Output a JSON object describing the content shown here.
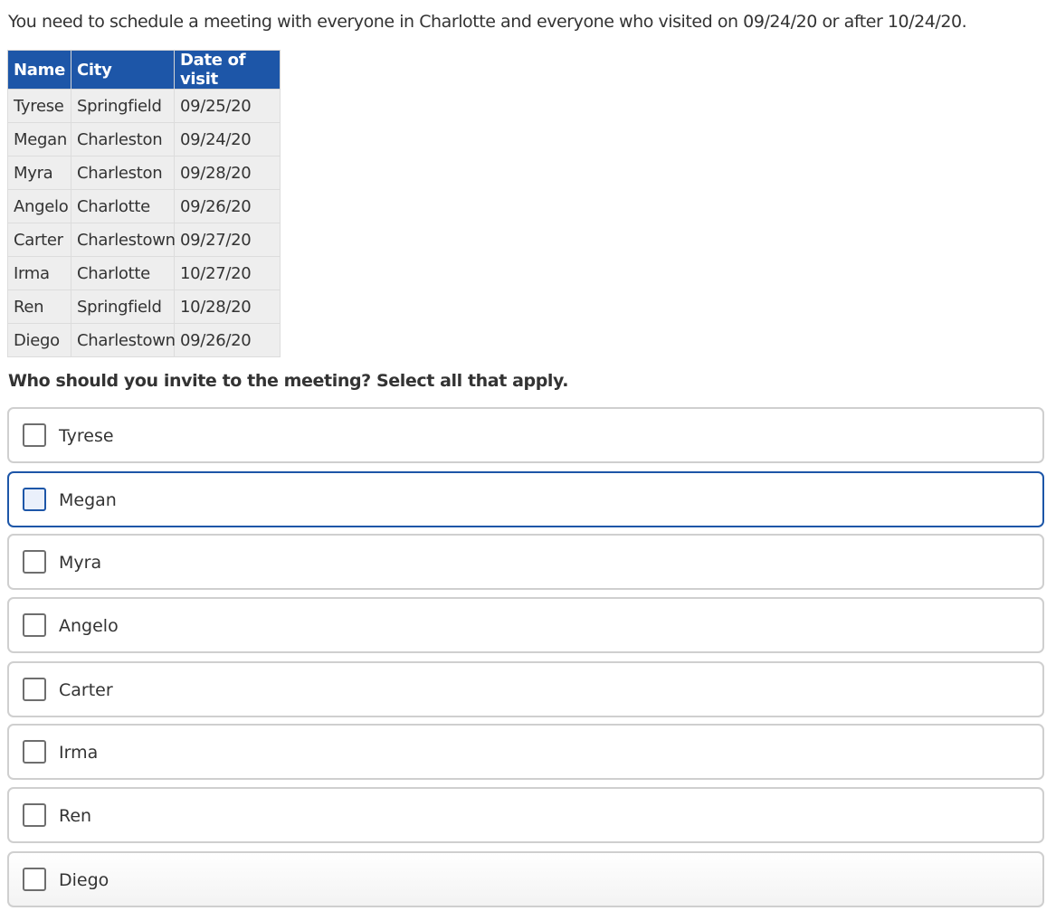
{
  "prompt": "You need to schedule a meeting with everyone in Charlotte and everyone who visited on 09/24/20 or after 10/24/20.",
  "table": {
    "headers": [
      "Name",
      "City",
      "Date of visit"
    ],
    "rows": [
      [
        "Tyrese",
        "Springfield",
        "09/25/20"
      ],
      [
        "Megan",
        "Charleston",
        "09/24/20"
      ],
      [
        "Myra",
        "Charleston",
        "09/28/20"
      ],
      [
        "Angelo",
        "Charlotte",
        "09/26/20"
      ],
      [
        "Carter",
        "Charlestown",
        "09/27/20"
      ],
      [
        "Irma",
        "Charlotte",
        "10/27/20"
      ],
      [
        "Ren",
        "Springfield",
        "10/28/20"
      ],
      [
        "Diego",
        "Charlestown",
        "09/26/20"
      ]
    ]
  },
  "question": "Who should you invite to the meeting? Select all that apply.",
  "options": [
    {
      "label": "Tyrese",
      "checked": false,
      "focused": false
    },
    {
      "label": "Megan",
      "checked": false,
      "focused": true
    },
    {
      "label": "Myra",
      "checked": false,
      "focused": false
    },
    {
      "label": "Angelo",
      "checked": false,
      "focused": false
    },
    {
      "label": "Carter",
      "checked": false,
      "focused": false
    },
    {
      "label": "Irma",
      "checked": false,
      "focused": false
    },
    {
      "label": "Ren",
      "checked": false,
      "focused": false
    },
    {
      "label": "Diego",
      "checked": false,
      "focused": false
    }
  ],
  "colors": {
    "header_bg": "#1d56a8",
    "cell_bg": "#eeeeee",
    "focus_border": "#1d56a8"
  }
}
